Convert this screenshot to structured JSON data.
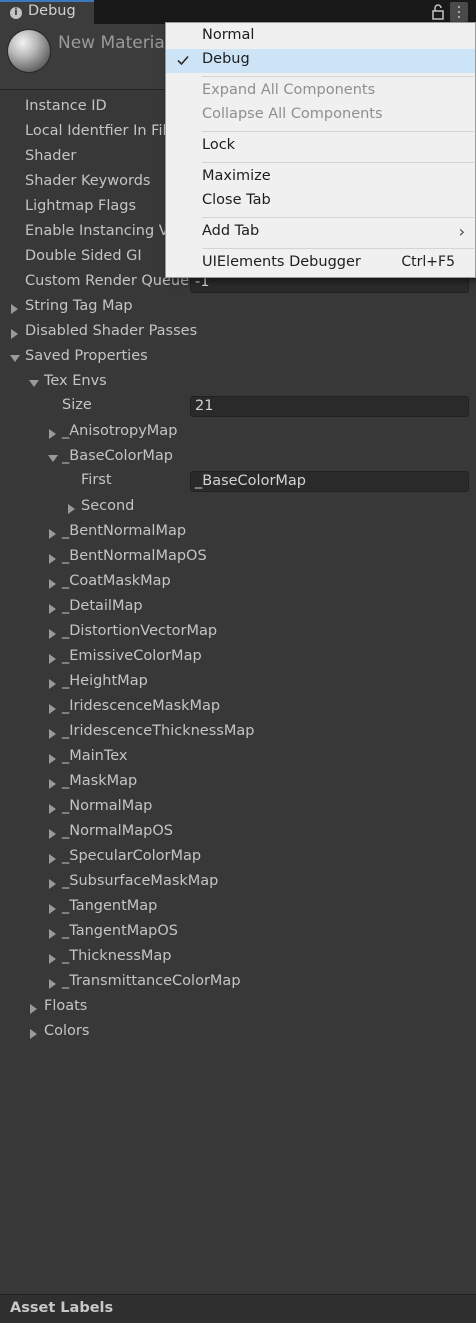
{
  "window": {
    "tab_title": "Debug",
    "material_name": "New Material"
  },
  "properties": [
    {
      "label": "Instance ID",
      "value": ""
    },
    {
      "label": "Local Identfier In File",
      "value": ""
    },
    {
      "label": "Shader",
      "value": ""
    },
    {
      "label": "Shader Keywords",
      "value": ""
    },
    {
      "label": "Lightmap Flags",
      "value": ""
    },
    {
      "label": "Enable Instancing Variants",
      "value": ""
    },
    {
      "label": "Double Sided GI",
      "value": ""
    },
    {
      "label": "Custom Render Queue",
      "value": "-1"
    }
  ],
  "foldouts": {
    "string_tag_map": "String Tag Map",
    "disabled_shader_passes": "Disabled Shader Passes",
    "saved_properties": "Saved Properties",
    "tex_envs": "Tex Envs",
    "size_label": "Size",
    "size_value": "21",
    "base_color_map": "_BaseColorMap",
    "first_label": "First",
    "first_value": "_BaseColorMap",
    "second_label": "Second",
    "floats": "Floats",
    "colors": "Colors"
  },
  "tex_env_items_before": [
    "_AnisotropyMap"
  ],
  "tex_env_items_after": [
    "_BentNormalMap",
    "_BentNormalMapOS",
    "_CoatMaskMap",
    "_DetailMap",
    "_DistortionVectorMap",
    "_EmissiveColorMap",
    "_HeightMap",
    "_IridescenceMaskMap",
    "_IridescenceThicknessMap",
    "_MainTex",
    "_MaskMap",
    "_NormalMap",
    "_NormalMapOS",
    "_SpecularColorMap",
    "_SubsurfaceMaskMap",
    "_TangentMap",
    "_TangentMapOS",
    "_ThicknessMap",
    "_TransmittanceColorMap"
  ],
  "footer": {
    "label": "Asset Labels"
  },
  "menu": {
    "normal": "Normal",
    "debug": "Debug",
    "expand_all": "Expand All Components",
    "collapse_all": "Collapse All Components",
    "lock": "Lock",
    "maximize": "Maximize",
    "close_tab": "Close Tab",
    "add_tab": "Add Tab",
    "ui_debugger": "UIElements Debugger",
    "ui_debugger_shortcut": "Ctrl+F5"
  },
  "colors": {
    "background": "#383838",
    "accent": "#3a79bb",
    "menu_background": "#f0f0f0",
    "menu_selected": "#cde4f7"
  }
}
